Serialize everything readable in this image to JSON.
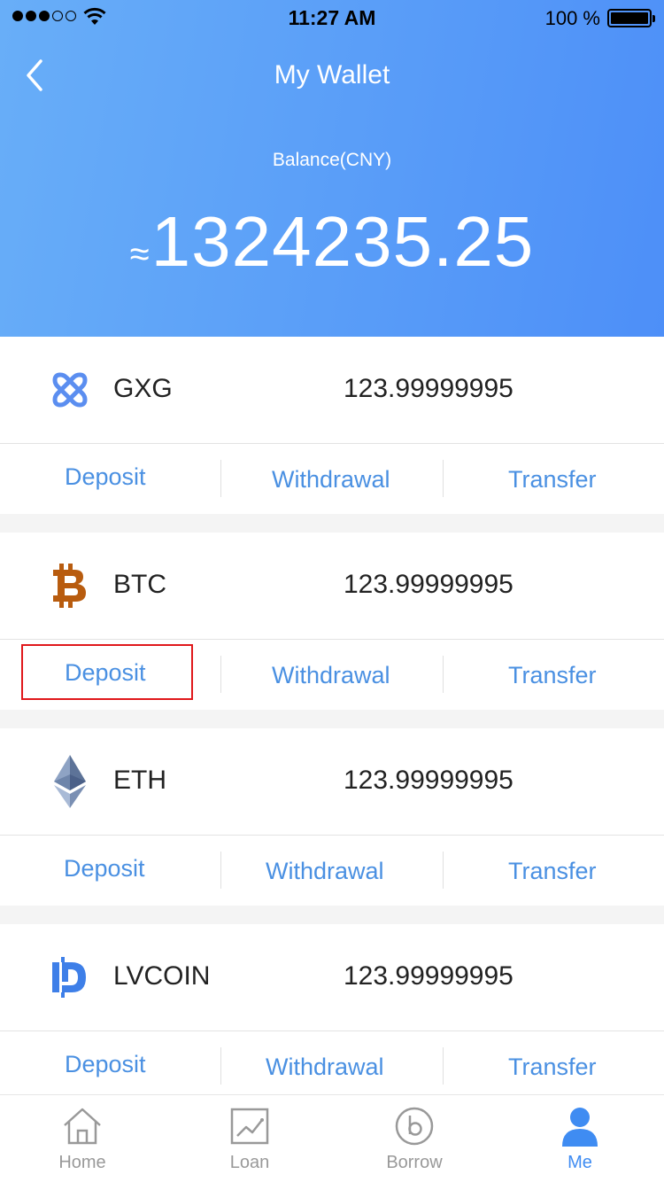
{
  "status": {
    "time": "11:27 AM",
    "battery": "100 %"
  },
  "header": {
    "title": "My Wallet",
    "balance_label": "Balance(CNY)",
    "approx_symbol": "≈",
    "balance": "1324235.25"
  },
  "coins": [
    {
      "name": "GXG",
      "amount": "123.99999995",
      "icon": "gxg-logo-icon"
    },
    {
      "name": "BTC",
      "amount": "123.99999995",
      "icon": "bitcoin-icon"
    },
    {
      "name": "ETH",
      "amount": "123.99999995",
      "icon": "ethereum-icon"
    },
    {
      "name": "LVCOIN",
      "amount": "123.99999995",
      "icon": "lvcoin-icon"
    }
  ],
  "actions": {
    "deposit": "Deposit",
    "withdrawal": "Withdrawal",
    "transfer": "Transfer"
  },
  "highlight": {
    "target": "BTC deposit button",
    "color": "#e0181b"
  },
  "tabbar": [
    {
      "label": "Home",
      "icon": "home-icon"
    },
    {
      "label": "Loan",
      "icon": "chart-icon"
    },
    {
      "label": "Borrow",
      "icon": "borrow-icon"
    },
    {
      "label": "Me",
      "icon": "user-icon",
      "active": true
    }
  ],
  "colors": {
    "header_start": "#68aef8",
    "header_end": "#4d8ff8",
    "accent": "#4a90e2",
    "active_tab": "#3f8cf2"
  }
}
